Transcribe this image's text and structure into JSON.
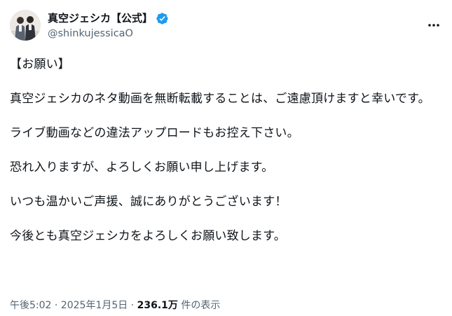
{
  "author": {
    "display_name": "真空ジェシカ【公式】",
    "handle": "@shinkujessicaO",
    "avatar_icon": "avatar-photo",
    "verified_icon": "verified-badge-icon",
    "verified_color": "#1d9bf0"
  },
  "menu_icon": "more-horizontal-icon",
  "post": {
    "paragraphs": [
      "【お願い】",
      "真空ジェシカのネタ動画を無断転載することは、ご遠慮頂けますと幸いです。",
      "ライブ動画などの違法アップロードもお控え下さい。",
      "恐れ入りますが、よろしくお願い申し上げます。",
      "いつも温かいご声援、誠にありがとうございます！",
      "今後とも真空ジェシカをよろしくお願い致します。"
    ]
  },
  "meta": {
    "time": "午後5:02",
    "separator": " · ",
    "date": "2025年1月5日",
    "views_count": "236.1万",
    "views_label": " 件の表示"
  }
}
